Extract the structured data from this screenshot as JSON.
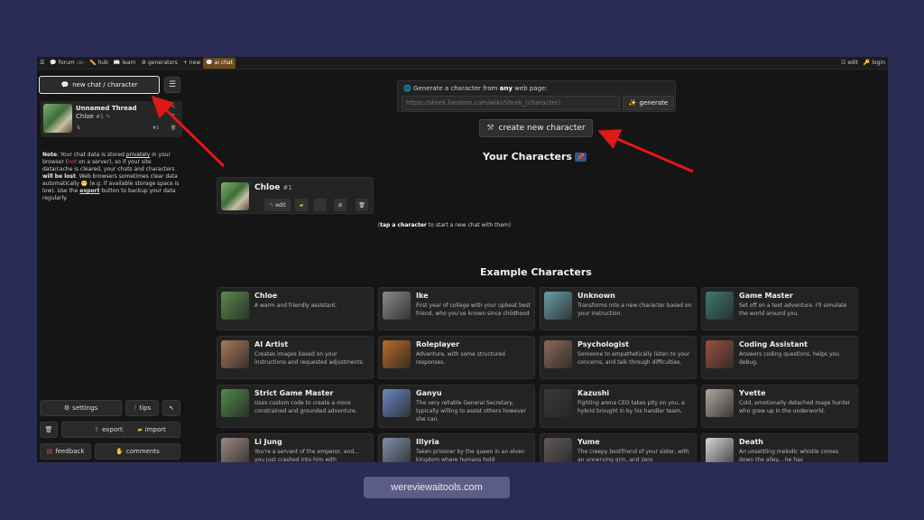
{
  "nav": {
    "items": [
      {
        "icon": "☰",
        "label": ""
      },
      {
        "icon": "💬",
        "label": "forum",
        "badge": "(36)"
      },
      {
        "icon": "✏️",
        "label": "hub"
      },
      {
        "icon": "📖",
        "label": "learn"
      },
      {
        "icon": "⚙",
        "label": "generators"
      },
      {
        "icon": "+",
        "label": "new"
      },
      {
        "icon": "💬",
        "label": "ai chat"
      }
    ],
    "right": [
      {
        "icon": "☷",
        "label": "edit"
      },
      {
        "icon": "🔑",
        "label": "login"
      }
    ]
  },
  "sidebar": {
    "new_chat_label": "new chat / character",
    "new_chat_icon": "💬",
    "menu_icon": "☰",
    "thread": {
      "title": "Unnamed Thread",
      "character": "Chloe",
      "number": "#1",
      "count": "#1"
    },
    "note": {
      "label": "Note",
      "t1": ": Your chat data is stored ",
      "privately": "privately",
      "t2": " in your browser (",
      "not": "not",
      "t3": " on a server), so if your site data/cache is cleared, your chats and characters ",
      "lost": "will be lost",
      "t4": ". Web browsers sometimes clear data automatically 😬 (e.g. if available storage space is low). Use the ",
      "export": "export",
      "t5": " button to backup your data regularly."
    },
    "buttons": {
      "settings": "settings",
      "tips": "tips",
      "export": "export",
      "import": "import",
      "feedback": "feedback",
      "comments": "comments"
    }
  },
  "generator": {
    "label_prefix": "Generate a character from ",
    "label_any": "any",
    "label_suffix": " web page:",
    "placeholder": "https://shrek.fandom.com/wiki/Shrek_(character)",
    "button": "generate"
  },
  "create_button": "create new character",
  "your_characters": {
    "title": "Your Characters",
    "pin": "📌",
    "items": [
      {
        "name": "Chloe",
        "number": "#1",
        "edit": "edit"
      }
    ],
    "hint_bold": "tap a character",
    "hint_rest": " to start a new chat with them"
  },
  "examples": {
    "title": "Example Characters",
    "cards": [
      {
        "name": "Chloe",
        "desc": "A warm and friendly assistant.",
        "color": "#5c8a4f"
      },
      {
        "name": "Ike",
        "desc": "First year of college with your upbeat best friend, who you've known since childhood",
        "color": "#8a8a8a"
      },
      {
        "name": "Unknown",
        "desc": "Transforms into a new character based on your instruction.",
        "color": "#6aa0a8"
      },
      {
        "name": "Game Master",
        "desc": "Set off on a text adventure. I'll simulate the world around you.",
        "color": "#3e7a6e"
      },
      {
        "name": "AI Artist",
        "desc": "Creates images based on your instructions and requested adjustments.",
        "color": "#a8785a"
      },
      {
        "name": "Roleplayer",
        "desc": "Adventure, with some structured responses.",
        "color": "#b86a2a"
      },
      {
        "name": "Psychologist",
        "desc": "Someone to empathetically listen to your concerns, and talk through difficulties.",
        "color": "#8a6a58"
      },
      {
        "name": "Coding Assistant",
        "desc": "Answers coding questions, helps you debug.",
        "color": "#9a5040"
      },
      {
        "name": "Strict Game Master",
        "desc": "Uses custom code to create a more constrained and grounded adventure.",
        "color": "#4f8a48"
      },
      {
        "name": "Ganyu",
        "desc": "The very reliable General Secretary, typically willing to assist others however she can.",
        "color": "#6a88c0"
      },
      {
        "name": "Kazushi",
        "desc": "Fighting arena CEO takes pity on you, a hybrid brought in by his handler team.",
        "color": "#3a3a3a"
      },
      {
        "name": "Yvette",
        "desc": "Cold, emotionally detached mage hunter who grew up in the underworld.",
        "color": "#b0a8a0"
      },
      {
        "name": "Li Jung",
        "desc": "You're a servant of the emperor, and... you just crashed into him with",
        "color": "#9a8a80"
      },
      {
        "name": "Illyria",
        "desc": "Taken prisoner by the queen in an elven kingdom where humans hold",
        "color": "#8090a8"
      },
      {
        "name": "Yume",
        "desc": "The creepy bestfriend of your sister, with an unnerving grin, and zero",
        "color": "#605a58"
      },
      {
        "name": "Death",
        "desc": "An unsettling melodic whistle comes down the alley... he has",
        "color": "#d8d8d8"
      }
    ]
  },
  "watermark": "wereviewaitools.com",
  "arrow_color": "#e01818"
}
